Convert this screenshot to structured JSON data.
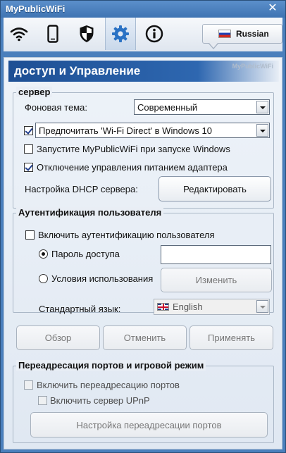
{
  "window": {
    "title": "MyPublicWiFi",
    "close_glyph": "✕"
  },
  "toolbar": {
    "icons": [
      "wifi-icon",
      "phone-icon",
      "shield-icon",
      "gear-icon",
      "info-icon"
    ],
    "active": "gear-icon",
    "language_label": "Russian"
  },
  "header": {
    "title": "доступ и Управление",
    "brand": "MyPublicWiFi"
  },
  "server": {
    "title": "сервер",
    "theme_label": "Фоновая тема:",
    "theme_value": "Современный",
    "prefer_wifi_direct_value": "Предпочитать 'Wi-Fi Direct' в Windows 10",
    "prefer_wifi_direct_checked": true,
    "autostart_label": "Запустите MyPublicWiFi при запуске Windows",
    "autostart_checked": false,
    "power_mgmt_label": "Отключение управления питанием адаптера",
    "power_mgmt_checked": true,
    "dhcp_label": "Настройка DHCP сервера:",
    "dhcp_button": "Редактировать"
  },
  "auth": {
    "title": "Аутентификация пользователя",
    "enable_label": "Включить аутентификацию пользователя",
    "enable_checked": false,
    "password_label": "Пароль доступа",
    "password_value": "",
    "terms_label": "Условия использования",
    "change_button": "Изменить",
    "language_label": "Стандартный язык:",
    "language_value": "English",
    "browse_button": "Обзор",
    "cancel_button": "Отменить",
    "apply_button": "Применять"
  },
  "ports": {
    "title": "Переадресация портов и игровой режим",
    "enable_forwarding_label": "Включить переадресацию портов",
    "enable_upnp_label": "Включить сервер UPnP",
    "settings_button": "Настройка переадресации портов"
  },
  "colors": {
    "accent": "#2e67b0",
    "titlebar": "#4a7fbc"
  }
}
